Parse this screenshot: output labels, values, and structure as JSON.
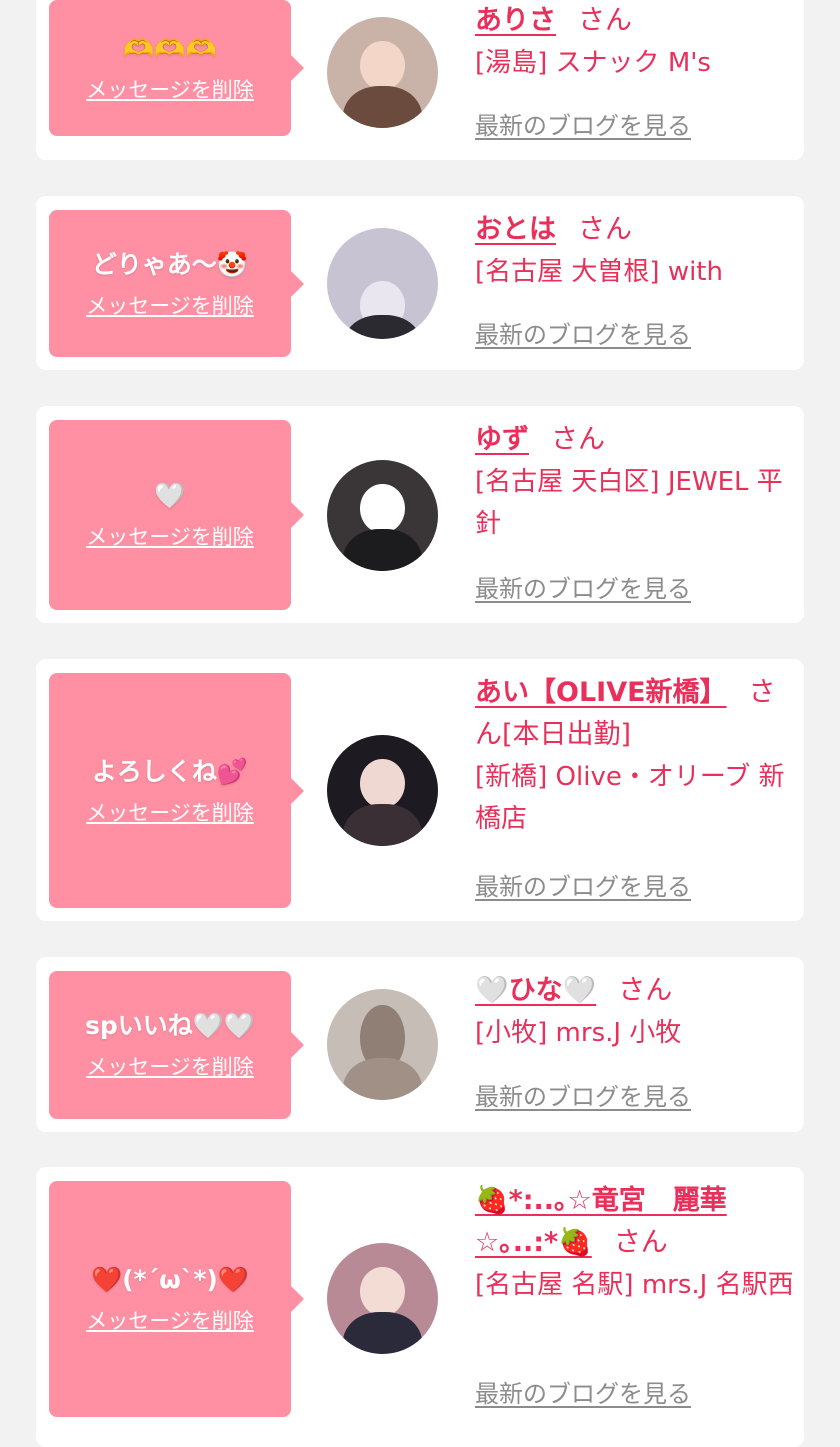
{
  "delete_label": "メッセージを削除",
  "san_label": "さん",
  "blog_label": "最新のブログを見る",
  "colors": {
    "background": "#f2f2f2",
    "card": "#ffffff",
    "bubble": "#ff8fa3",
    "accent": "#e8305a",
    "link_gray": "#8c8c8c"
  },
  "items": [
    {
      "message": "🫶🫶🫶",
      "name": "ありさ",
      "shop": "[湯島] スナック M's",
      "avatar": "avatar-photo"
    },
    {
      "message": "どりゃあ〜🤡",
      "name": "おとは",
      "shop": "[名古屋 大曽根] with",
      "avatar": "avatar-photo"
    },
    {
      "message": "🤍",
      "name": "ゆず",
      "shop": "[名古屋 天白区] JEWEL 平針",
      "avatar": "avatar-photo"
    },
    {
      "message": "よろしくね💕",
      "name": "あい【OLIVE新橋】",
      "name_suffix": "[本日出勤]",
      "shop": "[新橋] Olive・オリーブ 新橋店",
      "avatar": "avatar-photo"
    },
    {
      "message": "spいいね🤍🤍",
      "name": "🤍ひな🤍",
      "shop": "[小牧] mrs.J 小牧",
      "avatar": "avatar-photo"
    },
    {
      "message": "❤️(*´ω`*)❤️",
      "name": "🍓*:..｡☆竜宮　麗華☆｡..:*🍓",
      "shop": "[名古屋 名駅] mrs.J 名駅西",
      "avatar": "avatar-photo"
    }
  ]
}
